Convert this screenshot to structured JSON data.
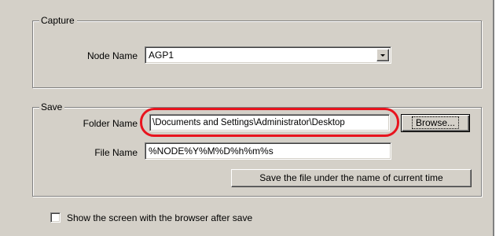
{
  "capture": {
    "title": "Capture",
    "node_name_label": "Node Name",
    "node_name_value": "AGP1"
  },
  "save": {
    "title": "Save",
    "folder_name_label": "Folder Name",
    "folder_name_value": "\\Documents and Settings\\Administrator\\Desktop",
    "browse_label": "Browse...",
    "file_name_label": "File Name",
    "file_name_value": "%NODE%Y%M%D%h%m%s",
    "current_time_button_label": "Save the file under the name of current time"
  },
  "options": {
    "show_browser_label": "Show the screen with the browser after save",
    "show_browser_checked": false
  },
  "icons": {
    "dropdown": "chevron-down-icon"
  },
  "colors": {
    "highlight": "#e8141e",
    "window_bg": "#d4d0c8"
  }
}
